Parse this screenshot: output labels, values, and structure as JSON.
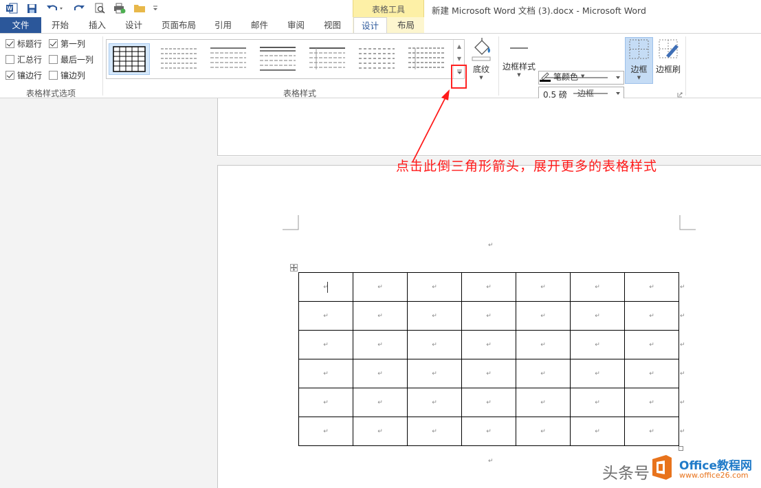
{
  "window": {
    "title": "新建 Microsoft Word 文档 (3).docx - Microsoft Word",
    "context_tab_group": "表格工具"
  },
  "tabs": {
    "file": "文件",
    "items": [
      "开始",
      "插入",
      "设计",
      "页面布局",
      "引用",
      "邮件",
      "审阅",
      "视图"
    ],
    "context_items": [
      "设计",
      "布局"
    ],
    "active": "设计"
  },
  "style_options": {
    "header_row": "标题行",
    "first_column": "第一列",
    "total_row": "汇总行",
    "last_column": "最后一列",
    "banded_rows": "镶边行",
    "banded_columns": "镶边列",
    "header_row_checked": true,
    "first_column_checked": true,
    "total_row_checked": false,
    "last_column_checked": false,
    "banded_rows_checked": true,
    "banded_columns_checked": false,
    "group_label": "表格样式选项"
  },
  "table_styles": {
    "group_label": "表格样式",
    "shading_label": "底纹"
  },
  "borders": {
    "border_styles_label": "边框样式",
    "line_weight": "0.5 磅",
    "pen_color_label": "笔颜色",
    "border_label": "边框",
    "border_painter_label": "边框刷",
    "group_label": "边框"
  },
  "document": {
    "table_rows": 6,
    "table_cols": 7
  },
  "annotation": "点击此倒三角形箭头，展开更多的表格样式",
  "watermark": {
    "text": "头条号",
    "brand": "Office教程网",
    "url": "www.office26.com"
  },
  "colors": {
    "file_tab": "#2b579a",
    "context_band": "#fdf0a6",
    "annotation": "#ff1a1a",
    "border_button": "#c5dcf5"
  }
}
